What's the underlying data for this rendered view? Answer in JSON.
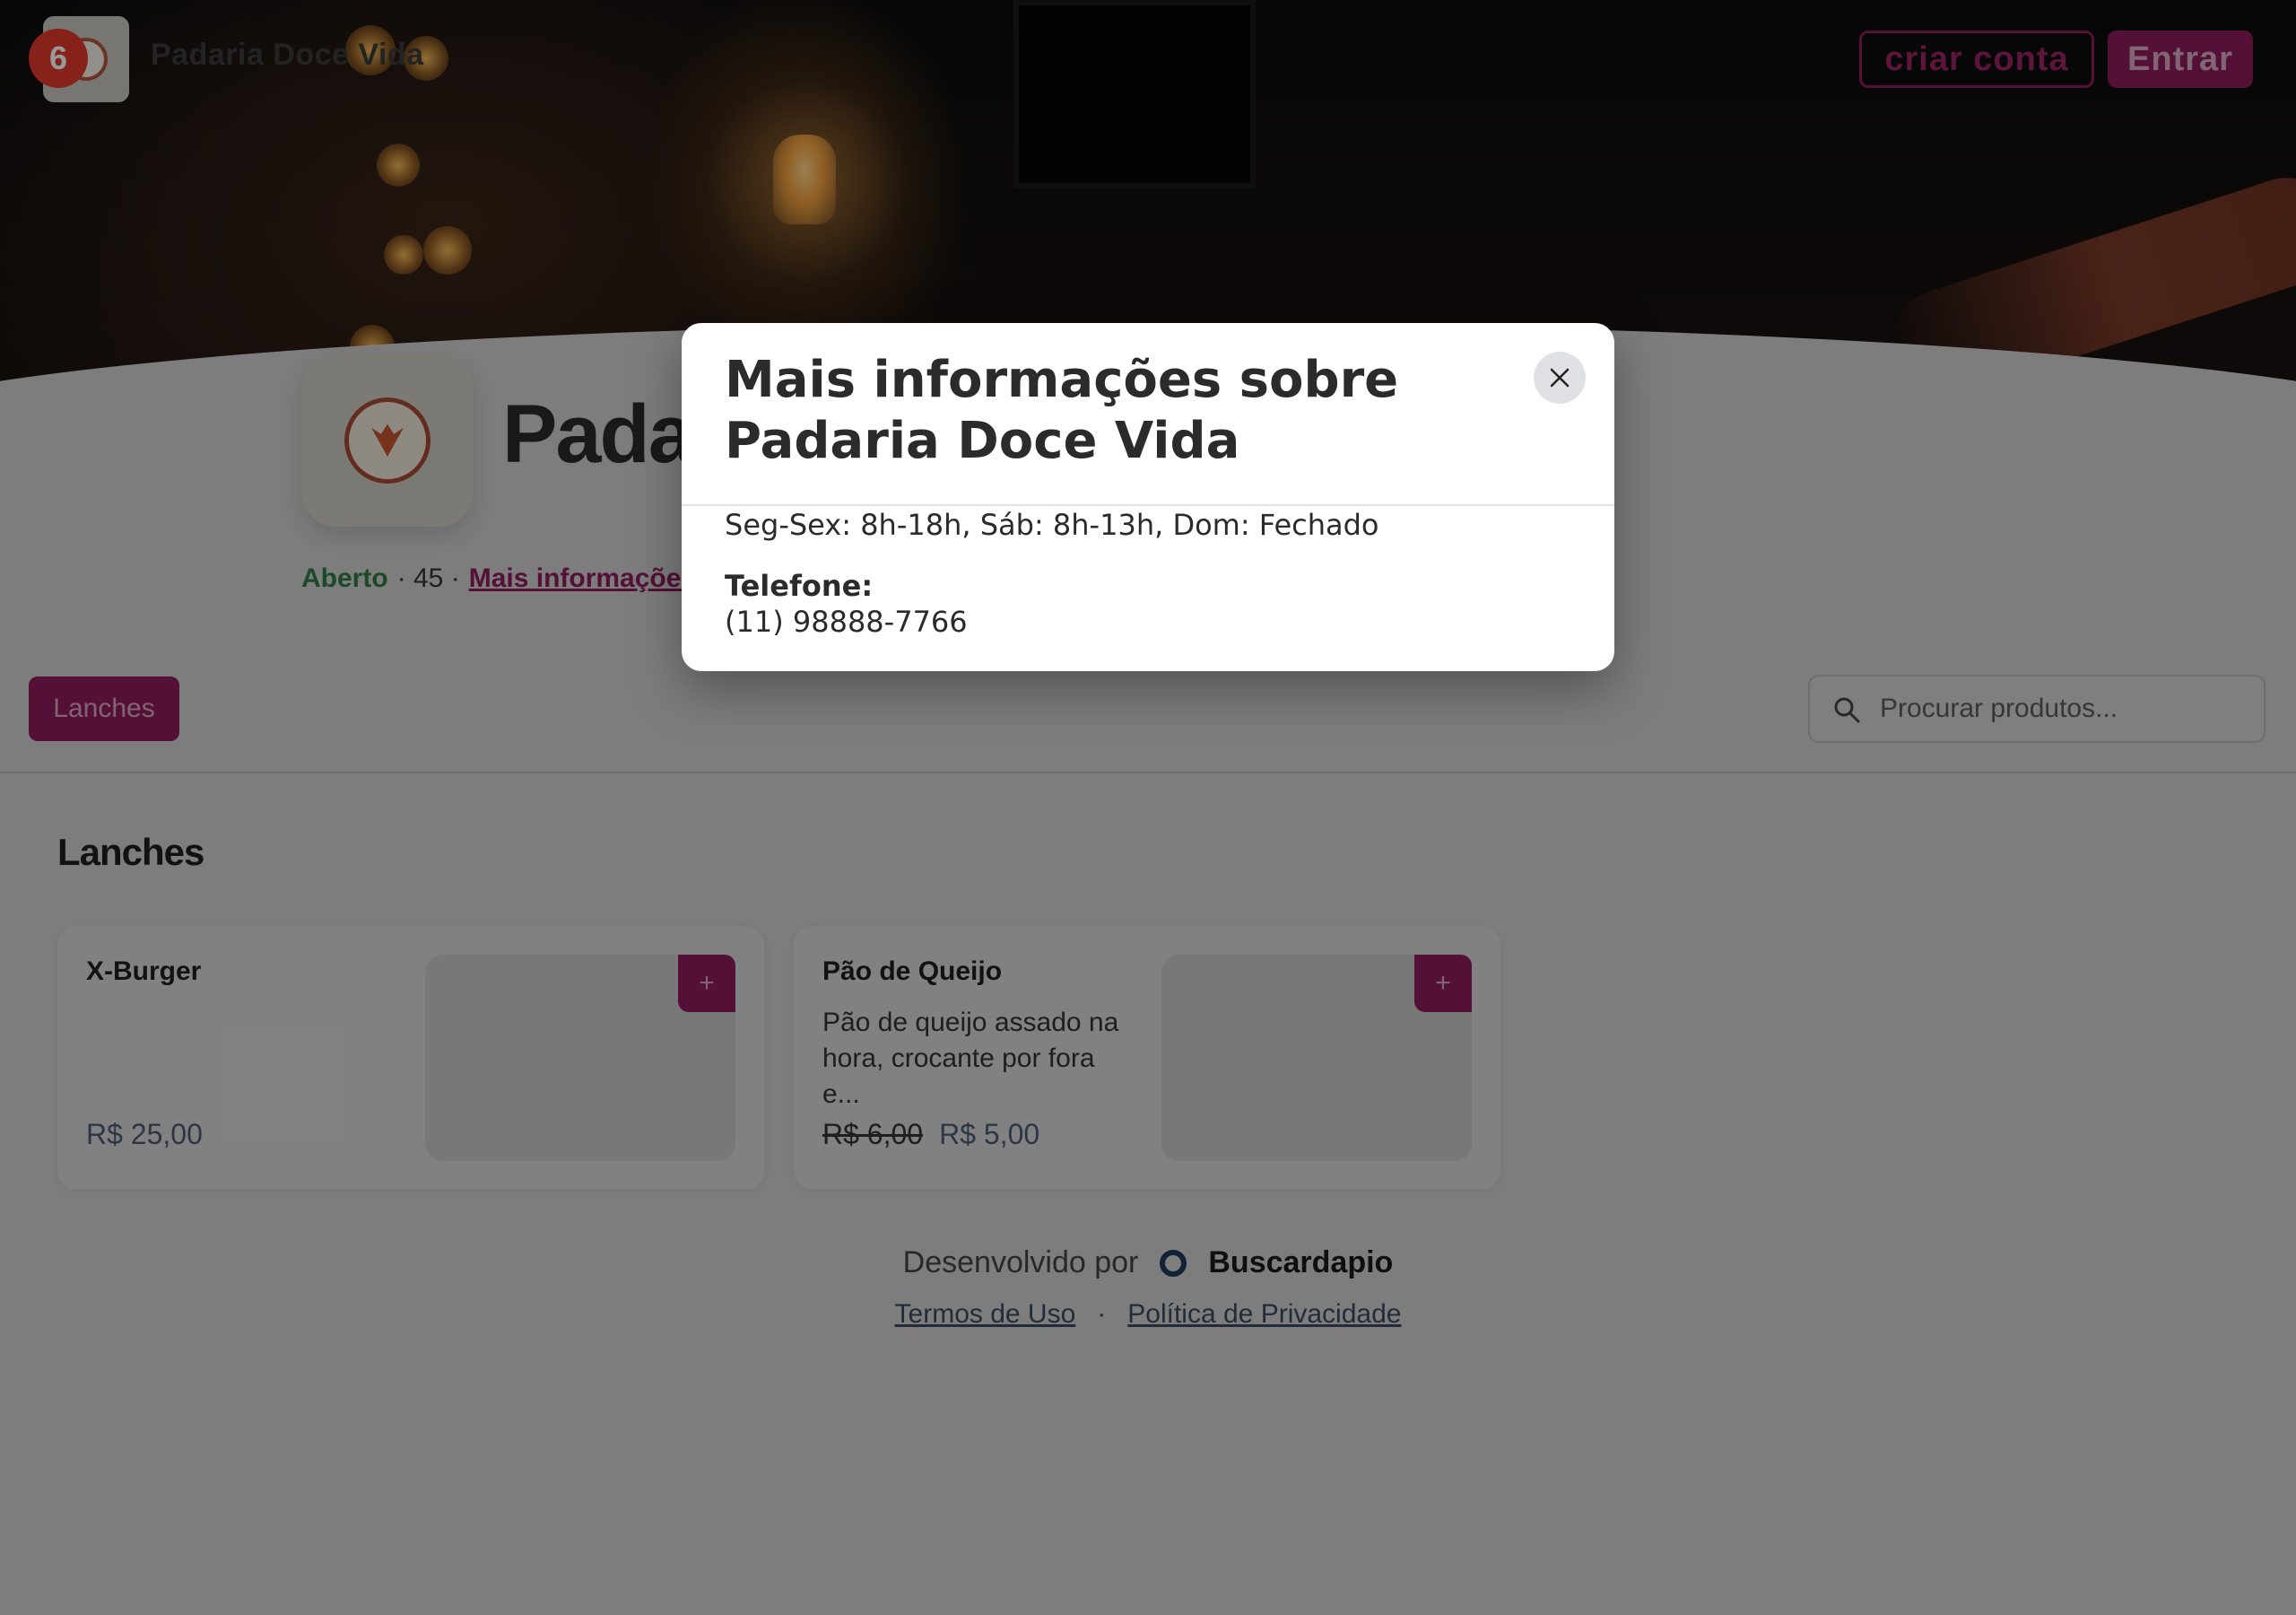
{
  "tab_badge": "6",
  "topbar": {
    "store_name": "Padaria Doce Vida",
    "create_account": "criar conta",
    "login": "Entrar"
  },
  "store": {
    "title_visible": "Padar",
    "status": "Aberto",
    "separator_count": "· 45 ·",
    "more_info": "Mais informações"
  },
  "categories": [
    {
      "label": "Lanches"
    }
  ],
  "search": {
    "placeholder": "Procurar produtos..."
  },
  "section": {
    "title": "Lanches"
  },
  "products": [
    {
      "name": "X-Burger",
      "description": "",
      "old_price": "",
      "price": "R$ 25,00",
      "add": "+"
    },
    {
      "name": "Pão de Queijo",
      "description": "Pão de queijo assado na hora, crocante por fora e...",
      "old_price": "R$ 6,00",
      "price": "R$ 5,00",
      "add": "+"
    }
  ],
  "footer": {
    "developed_by": "Desenvolvido por",
    "brand": "Buscardapio",
    "terms": "Termos de Uso",
    "dot": "·",
    "privacy": "Política de Privacidade"
  },
  "modal": {
    "title": "Mais informações sobre Padaria Doce Vida",
    "hours": "Seg-Sex: 8h-18h, Sáb: 8h-13h, Dom: Fechado",
    "phone_label": "Telefone:",
    "phone": "(11) 98888-7766"
  },
  "colors": {
    "brand": "#8c1c5a",
    "open": "#2f7a45",
    "badge": "#e03a2a"
  }
}
